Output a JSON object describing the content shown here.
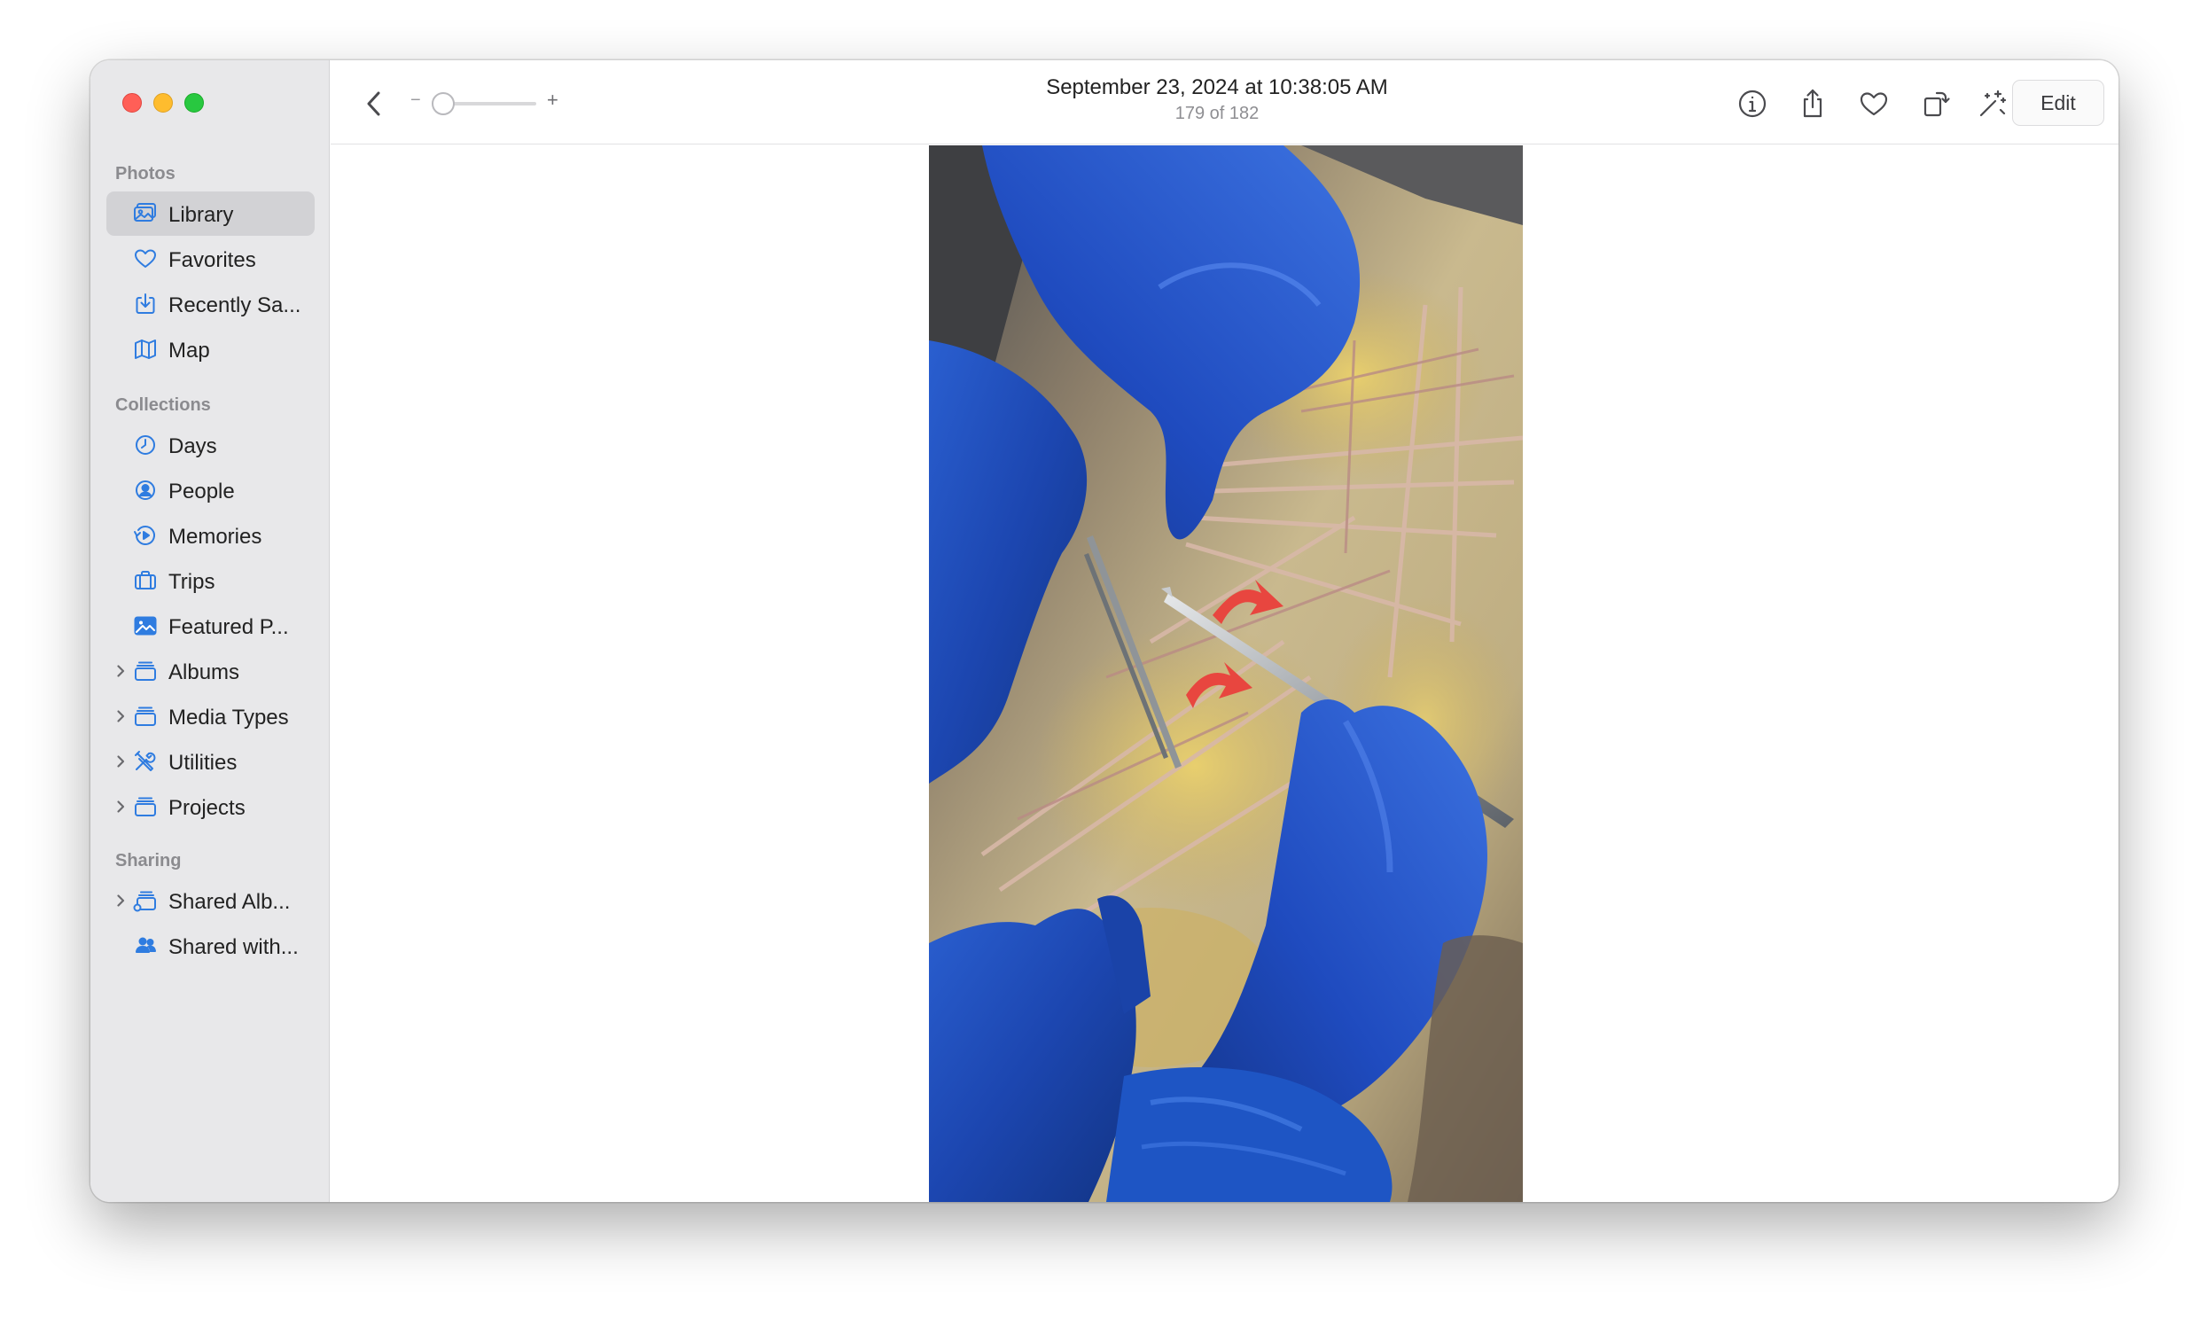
{
  "window": {
    "title": "September 23, 2024 at 10:38:05 AM",
    "subtitle": "179 of 182"
  },
  "toolbar": {
    "zoom_minus": "−",
    "zoom_plus": "+",
    "zoom_level": 0.0,
    "edit_label": "Edit",
    "icons": [
      "back-chevron-icon",
      "info-icon",
      "share-icon",
      "heart-icon",
      "rotate-icon",
      "magic-wand-icon"
    ]
  },
  "sidebar": {
    "photos_title": "Photos",
    "collections_title": "Collections",
    "sharing_title": "Sharing",
    "photos": [
      {
        "label": "Library",
        "icon": "library-icon",
        "selected": true
      },
      {
        "label": "Favorites",
        "icon": "heart-icon"
      },
      {
        "label": "Recently Sa...",
        "icon": "recently-saved-icon"
      },
      {
        "label": "Map",
        "icon": "map-icon"
      }
    ],
    "collections": [
      {
        "label": "Days",
        "icon": "clock-icon"
      },
      {
        "label": "People",
        "icon": "person-circle-icon"
      },
      {
        "label": "Memories",
        "icon": "memories-icon"
      },
      {
        "label": "Trips",
        "icon": "suitcase-icon"
      },
      {
        "label": "Featured P...",
        "icon": "photo-icon"
      },
      {
        "label": "Albums",
        "icon": "folder-stack-icon",
        "expandable": true
      },
      {
        "label": "Media Types",
        "icon": "folder-stack-icon",
        "expandable": true
      },
      {
        "label": "Utilities",
        "icon": "tools-icon",
        "expandable": true
      },
      {
        "label": "Projects",
        "icon": "folder-stack-icon",
        "expandable": true
      }
    ],
    "sharing": [
      {
        "label": "Shared Alb...",
        "icon": "shared-album-icon",
        "expandable": true
      },
      {
        "label": "Shared with...",
        "icon": "shared-people-icon"
      }
    ]
  },
  "colors": {
    "accent": "#2f7ce0",
    "sidebar_bg": "#e8e8ea",
    "selected_bg": "#d2d2d5",
    "close": "#ff5f57",
    "minimize": "#febc2e",
    "zoom": "#28c840"
  }
}
